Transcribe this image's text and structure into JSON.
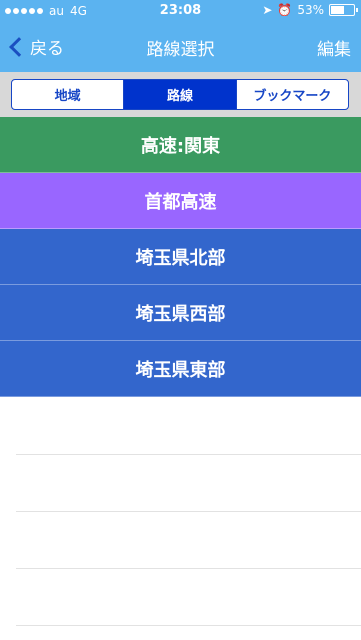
{
  "status": {
    "carrier": "au",
    "network": "4G",
    "time": "23:08",
    "battery": "53%",
    "battery_level": 0.53
  },
  "nav": {
    "back_label": "戻る",
    "title": "路線選択",
    "edit_label": "編集"
  },
  "segments": [
    {
      "label": "地域",
      "active": false
    },
    {
      "label": "路線",
      "active": true
    },
    {
      "label": "ブックマーク",
      "active": false
    }
  ],
  "rows": [
    {
      "label": "高速:関東",
      "color": "#3a9a60"
    },
    {
      "label": "首都高速",
      "color": "#9966ff"
    },
    {
      "label": "埼玉県北部",
      "color": "#3366cc"
    },
    {
      "label": "埼玉県西部",
      "color": "#3366cc"
    },
    {
      "label": "埼玉県東部",
      "color": "#3366cc"
    }
  ]
}
